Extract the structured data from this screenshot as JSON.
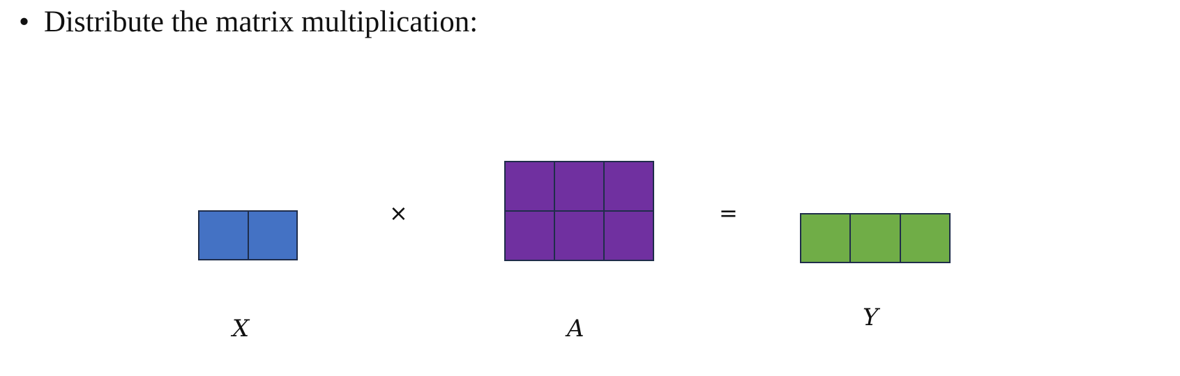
{
  "slide": {
    "bullet_symbol": "•",
    "bullet_text": "Distribute the matrix multiplication:"
  },
  "operators": {
    "times": "×",
    "equals": "="
  },
  "matrices": {
    "x": {
      "label": "X",
      "rows": 1,
      "cols": 2,
      "color": "#4472c4"
    },
    "a": {
      "label": "A",
      "rows": 2,
      "cols": 3,
      "color": "#7030a0"
    },
    "y": {
      "label": "Y",
      "rows": 1,
      "cols": 3,
      "color": "#70ad47"
    }
  },
  "colors": {
    "cell_border": "#1f2d4a"
  }
}
